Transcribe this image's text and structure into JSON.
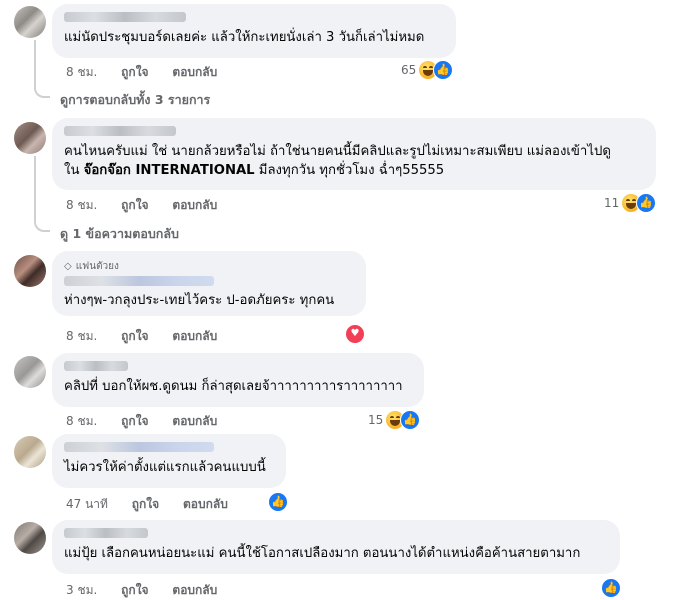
{
  "comments": [
    {
      "text": "แม่นัดประชุมบอร์ดเลยค่ะ แล้วให้กะเทยนั่งเล่า 3 วันก็เล่าไม่หมด",
      "time": "8 ชม.",
      "like_action": "ถูกใจ",
      "reply_action": "ตอบกลับ",
      "reaction_count": "65",
      "reactions": [
        "haha-icon",
        "like-icon"
      ],
      "view_replies": "ดูการตอบกลับทั้ง 3 รายการ"
    },
    {
      "text_line1": "คนไหนครับแม่ ใช่ นายกล้วยหรือไม่ ถ้าใช่นายคนนี้มีคลิปและรูปไม่เหมาะสมเพียบ แม่ลองเข้าไปดู",
      "text_line2_prefix": "ใน ",
      "text_line2_bold": "จ๊อกจ๊อก INTERNATIONAL",
      "text_line2_suffix": " มีลงทุกวัน ทุกชั่วโมง ฉ่ำๆ55555",
      "time": "8 ชม.",
      "like_action": "ถูกใจ",
      "reply_action": "ตอบกลับ",
      "reaction_count": "11",
      "reactions": [
        "haha-icon",
        "like-icon"
      ],
      "view_replies": "ดู 1 ข้อความตอบกลับ"
    },
    {
      "badge": "แฟนตัวยง",
      "text": "ห่างๆพ-วกลุงประ-เทยไว้คระ ป-อดภัยคระ ทุกคน",
      "time": "8 ชม.",
      "like_action": "ถูกใจ",
      "reply_action": "ตอบกลับ",
      "reactions": [
        "love-icon"
      ]
    },
    {
      "text": "คลิปที่ บอกให้ผช.ดูดนม ก็ล่าสุดเลยจ้าาาาาาาาาราาาาาาาา",
      "time": "8 ชม.",
      "like_action": "ถูกใจ",
      "reply_action": "ตอบกลับ",
      "reaction_count": "15",
      "reactions": [
        "haha-icon",
        "like-icon"
      ]
    },
    {
      "text": "ไม่ควรให้ค่าตั้งแต่แรกแล้วคนแบบนี้",
      "time": "47 นาที",
      "like_action": "ถูกใจ",
      "reply_action": "ตอบกลับ",
      "reactions": [
        "like-icon"
      ]
    },
    {
      "text": "แม่ปุ้ย เลือกคนหน่อยนะแม่ คนนี้ใช้โอกาสเปลืองมาก ตอนนางได้ตำแหน่งคือค้านสายตามาก",
      "time": "3 ชม.",
      "like_action": "ถูกใจ",
      "reply_action": "ตอบกลับ",
      "reactions": [
        "like-icon"
      ]
    }
  ],
  "colors": {
    "bubble": "#f0f2f5",
    "meta_text": "#65676b",
    "like_blue": "#1877f2",
    "love_red": "#f33e58"
  }
}
